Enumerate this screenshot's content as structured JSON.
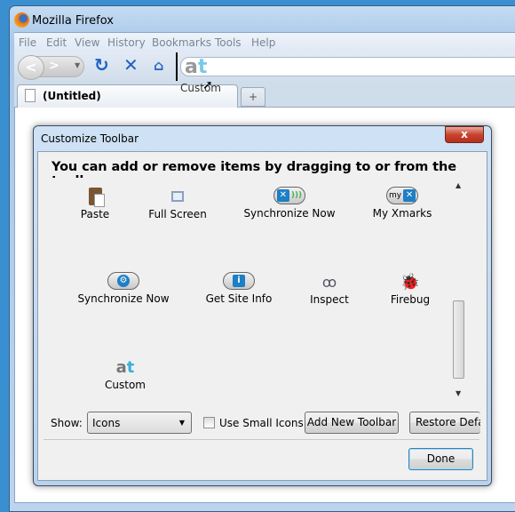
{
  "window": {
    "title": "Mozilla Firefox"
  },
  "menu": [
    "File",
    "Edit",
    "View",
    "History",
    "Bookmarks",
    "Tools",
    "Help"
  ],
  "tab": {
    "label": "(Untitled)",
    "new_tab": "+"
  },
  "drag": {
    "icon_text": "at",
    "label": "Custom"
  },
  "dialog": {
    "title": "Customize Toolbar",
    "close": "x",
    "heading": "You can add or remove items by dragging to or from the toolbars.",
    "items": [
      {
        "label": "Paste",
        "icon": "paste-icon"
      },
      {
        "label": "Full Screen",
        "icon": "fullscreen-icon"
      },
      {
        "label": "Synchronize Now",
        "icon": "xmarks-sync-icon"
      },
      {
        "label": "My Xmarks",
        "icon": "my-xmarks-icon"
      },
      {
        "label": "Synchronize Now",
        "icon": "sync-gear-icon"
      },
      {
        "label": "Get Site Info",
        "icon": "site-info-icon"
      },
      {
        "label": "Inspect",
        "icon": "inspect-icon"
      },
      {
        "label": "Firebug",
        "icon": "firebug-icon"
      },
      {
        "label": "Custom",
        "icon": "at-icon",
        "icon_text": "at"
      }
    ],
    "show_label": "Show:",
    "show_value": "Icons",
    "small_icons_label": "Use Small Icons",
    "small_icons_checked": false,
    "add_toolbar": "Add New Toolbar",
    "restore": "Restore Default Set",
    "done": "Done",
    "my_text": "my"
  }
}
